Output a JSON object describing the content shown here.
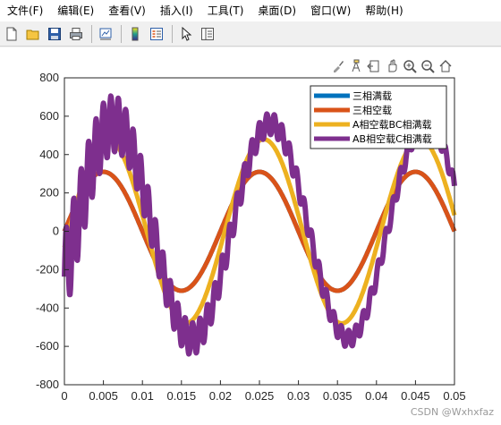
{
  "menubar": {
    "items": [
      "文件(F)",
      "编辑(E)",
      "查看(V)",
      "插入(I)",
      "工具(T)",
      "桌面(D)",
      "窗口(W)",
      "帮助(H)"
    ]
  },
  "toolbar": {
    "buttons": [
      "new-file-icon",
      "open-folder-icon",
      "save-icon",
      "print-icon",
      "link-plot-icon",
      "colorbar-icon",
      "legend-icon",
      "edit-plot-arrow-icon",
      "property-editor-icon"
    ]
  },
  "axes_toolbar": {
    "buttons": [
      "brush-icon",
      "data-tips-icon",
      "restore-view-icon",
      "pan-hand-icon",
      "zoom-in-icon",
      "zoom-out-icon",
      "home-icon"
    ]
  },
  "watermark": "CSDN @Wxhxfaz",
  "colors": {
    "series1": "#0072BD",
    "series2": "#D95319",
    "series3": "#EDB120",
    "series4": "#7E2F8E"
  },
  "chart_data": {
    "type": "line",
    "xlim": [
      0,
      0.05
    ],
    "ylim": [
      -800,
      800
    ],
    "xticks": [
      "0",
      "0.005",
      "0.01",
      "0.015",
      "0.02",
      "0.025",
      "0.03",
      "0.035",
      "0.04",
      "0.045",
      "0.05"
    ],
    "yticks": [
      "800",
      "600",
      "400",
      "200",
      "0",
      "-200",
      "-400",
      "-600",
      "-800"
    ],
    "legend_position": "top-right",
    "grid": false,
    "frequency_hz": 50,
    "series": [
      {
        "name": "三相满载",
        "amplitude": 310,
        "phase_deg": 0
      },
      {
        "name": "三相空载",
        "amplitude": 310,
        "phase_deg": 0
      },
      {
        "name": "A相空载BC相满载",
        "amplitude": 480,
        "phase_deg": -10
      },
      {
        "name": "AB相空载C相满载",
        "amplitude": 560,
        "phase_deg": -25
      }
    ]
  }
}
